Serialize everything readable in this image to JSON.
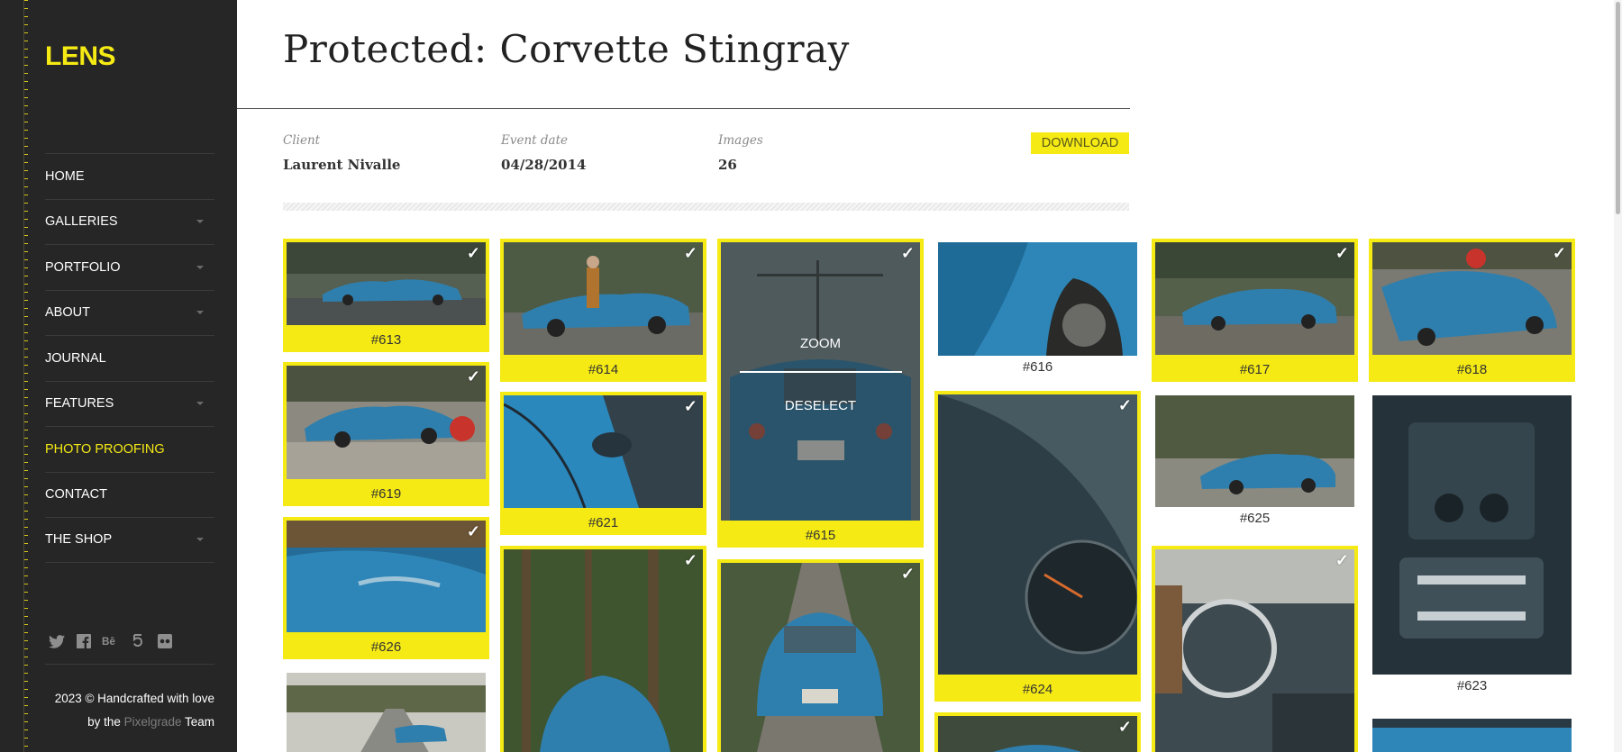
{
  "sidebar": {
    "logo": "LENS",
    "nav": [
      {
        "label": "HOME",
        "caret": false,
        "active": false
      },
      {
        "label": "GALLERIES",
        "caret": true,
        "active": false
      },
      {
        "label": "PORTFOLIO",
        "caret": true,
        "active": false
      },
      {
        "label": "ABOUT",
        "caret": true,
        "active": false
      },
      {
        "label": "JOURNAL",
        "caret": false,
        "active": false
      },
      {
        "label": "FEATURES",
        "caret": true,
        "active": false
      },
      {
        "label": "PHOTO PROOFING",
        "caret": false,
        "active": true
      },
      {
        "label": "CONTACT",
        "caret": false,
        "active": false
      },
      {
        "label": "THE SHOP",
        "caret": true,
        "active": false
      }
    ],
    "social_icons": [
      "twitter-icon",
      "facebook-icon",
      "behance-icon",
      "fivehundredpx-icon",
      "flickr-icon"
    ],
    "footer": {
      "line1": "2023 © Handcrafted with love",
      "by": "by the",
      "brand": "Pixelgrade",
      "team": "Team"
    }
  },
  "page": {
    "title": "Protected: Corvette Stingray",
    "meta": {
      "client_label": "Client",
      "client_value": "Laurent Nivalle",
      "date_label": "Event date",
      "date_value": "04/28/2014",
      "images_label": "Images",
      "images_value": "26"
    },
    "download_label": "DOWNLOAD"
  },
  "gallery": {
    "zoom_label": "ZOOM",
    "deselect_label": "DESELECT",
    "check_glyph": "✓",
    "items": [
      {
        "caption": "#613",
        "selected": true
      },
      {
        "caption": "#619",
        "selected": true
      },
      {
        "caption": "#626",
        "selected": true
      },
      {
        "caption": "",
        "selected": false
      },
      {
        "caption": "#614",
        "selected": true
      },
      {
        "caption": "#621",
        "selected": true
      },
      {
        "caption": "",
        "selected": true
      },
      {
        "caption": "#615",
        "selected": true
      },
      {
        "caption": "",
        "selected": true
      },
      {
        "caption": "#616",
        "selected": false
      },
      {
        "caption": "#624",
        "selected": true
      },
      {
        "caption": "",
        "selected": true
      },
      {
        "caption": "#617",
        "selected": true
      },
      {
        "caption": "#625",
        "selected": false
      },
      {
        "caption": "",
        "selected": true
      },
      {
        "caption": "#618",
        "selected": true
      },
      {
        "caption": "#623",
        "selected": false
      },
      {
        "caption": "",
        "selected": false
      }
    ]
  },
  "colors": {
    "accent": "#f5ea14",
    "sidebar_bg": "#262626",
    "car_blue": "#2f7fae"
  }
}
